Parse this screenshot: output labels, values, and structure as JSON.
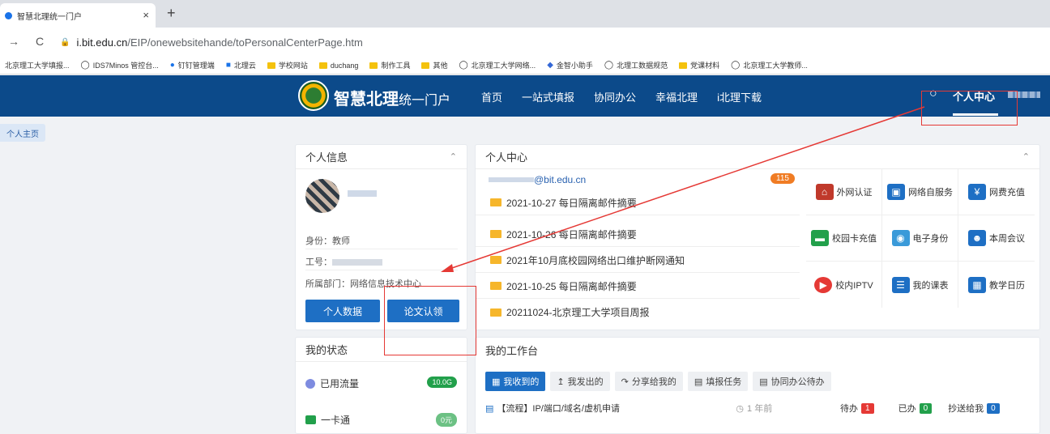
{
  "browser": {
    "tab_title": "智慧北理统一门户",
    "tab_close": "×",
    "new_tab": "+",
    "back": "→",
    "reload": "C",
    "url_host": "i.bit.edu.cn",
    "url_path": "/EIP/onewebsitehande/toPersonalCenterPage.htm",
    "bookmarks": [
      "北京理工大学填报...",
      "IDS7Minos 管控台...",
      "钉钉管理端",
      "北理云",
      "学校网站",
      "duchang",
      "制作工具",
      "其他",
      "北京理工大学网络...",
      "金智小助手",
      "北理工数据规范",
      "党课材料",
      "北京理工大学教师..."
    ]
  },
  "header": {
    "brand_main": "智慧北理",
    "brand_sub": "统一门户",
    "nav": [
      "首页",
      "一站式填报",
      "协同办公",
      "幸福北理",
      "i北理下载"
    ],
    "personal_center": "个人中心",
    "search_icon": "○"
  },
  "side_tag": "个人主页",
  "personal_info": {
    "title": "个人信息",
    "identity": "身份：教师",
    "job_id_label": "工号：",
    "department": "所属部门：网络信息技术中心",
    "btn_data": "个人数据",
    "btn_paper": "论文认领"
  },
  "center": {
    "title": "个人中心",
    "email_suffix": "@bit.edu.cn",
    "unread": "115",
    "mails": [
      "2021-10-27 每日隔离邮件摘要",
      "2021-10-26 每日隔离邮件摘要",
      "2021年10月底校园网络出口维护断网通知",
      "2021-10-25 每日隔离邮件摘要",
      "20211024-北京理工大学项目周报"
    ],
    "apps": [
      "外网认证",
      "网络自服务",
      "网费充值",
      "校园卡充值",
      "电子身份",
      "本周会议",
      "校内IPTV",
      "我的课表",
      "教学日历"
    ]
  },
  "status": {
    "title": "我的状态",
    "rows": [
      {
        "label": "已用流量",
        "value": "10.0G"
      },
      {
        "label": "一卡通",
        "value": "0元"
      }
    ]
  },
  "workbench": {
    "title": "我的工作台",
    "tabs": [
      "我收到的",
      "我发出的",
      "分享给我的",
      "填报任务",
      "协同办公待办"
    ],
    "row": {
      "title": "【流程】IP/端口/域名/虚机申请",
      "time": "1 年前",
      "pending_label": "待办",
      "pending": "1",
      "done_label": "已办",
      "done": "0",
      "cc_label": "抄送给我",
      "cc": "0"
    }
  }
}
